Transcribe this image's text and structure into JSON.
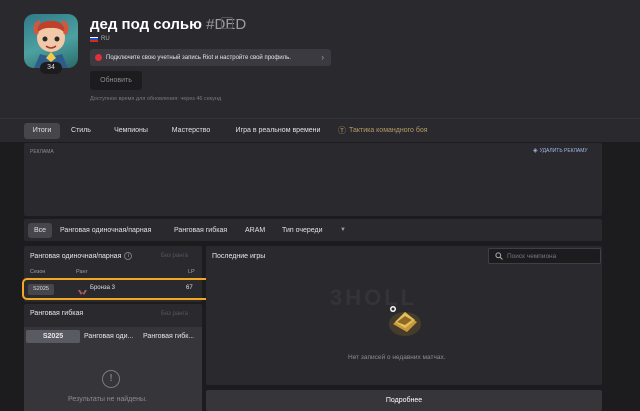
{
  "profile": {
    "name": "дед под солью",
    "tag": "#DED",
    "region": "RU",
    "level": "34",
    "riot_notice": "Подключите свою учетный запись Riot и настройте свой профиль.",
    "update_button": "Обновить",
    "update_hint": "Доступное время для обновления: через 46 секунд"
  },
  "nav": {
    "tabs": [
      "Итоги",
      "Стиль",
      "Чемпионы",
      "Мастерство",
      "Игра в реальном времени",
      "Тактика командного боя"
    ],
    "active_index": 0
  },
  "ad": {
    "label": "РЕКЛАМА",
    "remove_label": "УДАЛИТЬ РЕКЛАМУ"
  },
  "queue_tabs": {
    "items": [
      "Все",
      "Ранговая одиночная/парная",
      "Ранговая гибкая",
      "ARAM",
      "Тип очереди"
    ],
    "active_index": 0
  },
  "solo": {
    "title": "Ранговая одиночная/парная",
    "unranked": "Без ранга",
    "col_season": "Сезон",
    "col_rank": "Ранг",
    "col_lp": "LP",
    "row": {
      "season": "S2025",
      "rank": "Бронза 3",
      "lp": "67"
    }
  },
  "flex": {
    "title": "Ранговая гибкая",
    "unranked": "Без ранга",
    "table_headers": [
      "S2025",
      "Ранговая оди...",
      "Ранговая гибк..."
    ],
    "empty": "Результаты не найдены."
  },
  "recent": {
    "title": "Последние игры",
    "search_placeholder": "Поиск чемпиона",
    "empty": "Нет записей о недавних матчах.",
    "watermark": "3HOLL",
    "more": "Подробнее"
  },
  "colors": {
    "highlight": "#f5a623",
    "riot_red": "#e0303b",
    "bg": "#1c1c1f",
    "panel": "#2a2a2e"
  },
  "icons": [
    "info-icon",
    "search-icon",
    "shield-icon",
    "chevron-right-icon",
    "chevron-down-icon",
    "exclamation-icon",
    "tft-icon",
    "rank-emblem-icon",
    "chest-icon"
  ]
}
